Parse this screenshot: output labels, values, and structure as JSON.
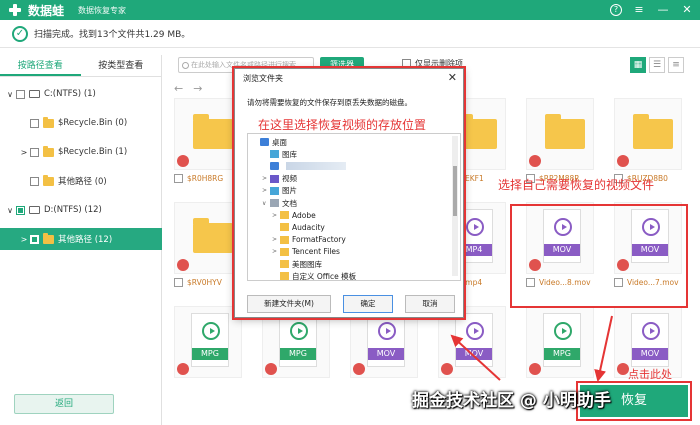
{
  "titlebar": {
    "app_name": "数据蛙",
    "subtitle": "数据恢复专家",
    "help_icon": "?",
    "menu_icon": "≡",
    "minimize_icon": "—",
    "close_icon": "✕"
  },
  "status": {
    "check_icon": "✓",
    "text": "扫描完成。找到13个文件共1.29 MB。"
  },
  "sidebar": {
    "tabs": [
      {
        "label": "按路径查看",
        "active": true
      },
      {
        "label": "按类型查看",
        "active": false
      }
    ],
    "tree": [
      {
        "chevron": "∨",
        "label": "C:(NTFS) (1)",
        "icon": "drive-icon",
        "selected": false
      },
      {
        "chevron": "",
        "label": "$Recycle.Bin (0)",
        "icon": "folder-icon",
        "selected": false
      },
      {
        "chevron": ">",
        "label": "$Recycle.Bin (1)",
        "icon": "folder-icon",
        "selected": false
      },
      {
        "chevron": "",
        "label": "其他路径 (0)",
        "icon": "folder-icon",
        "selected": false
      },
      {
        "chevron": "∨",
        "label": "D:(NTFS) (12)",
        "icon": "drive-icon",
        "selected": false
      },
      {
        "chevron": ">",
        "label": "其他路径 (12)",
        "icon": "folder-icon",
        "selected": true
      }
    ],
    "back_label": "返回"
  },
  "toolbar": {
    "search_placeholder": "在此处输入文件名或路径进行搜索",
    "filter_label": "筛选器",
    "show_deleted_label": "仅显示删除项",
    "view_icons": [
      "▦",
      "☰",
      "≡"
    ],
    "nav_back": "←",
    "nav_forward": "→"
  },
  "grid": {
    "tiles": [
      {
        "kind": "folder",
        "label": "$R0H8RG",
        "checked": false
      },
      {
        "kind": "folder",
        "label": "",
        "checked": false
      },
      {
        "kind": "folder",
        "label": "",
        "checked": false
      },
      {
        "kind": "folder",
        "label": "$RTEKF1",
        "checked": false
      },
      {
        "kind": "folder",
        "label": "$RP2M88R",
        "checked": false
      },
      {
        "kind": "folder",
        "label": "$RUZD8B0",
        "checked": false
      },
      {
        "kind": "folder",
        "label": "$RV0HYV",
        "checked": false
      },
      {
        "kind": "video",
        "badge": "MP4",
        "label": "...9.mp4",
        "checked": false
      },
      {
        "kind": "video",
        "badge": "MOV",
        "label": "Video...8.mov",
        "checked": false
      },
      {
        "kind": "video",
        "badge": "MOV",
        "label": "Video...7.mov",
        "checked": false
      },
      {
        "kind": "video",
        "badge": "MPG",
        "label": "",
        "checked": false
      },
      {
        "kind": "video",
        "badge": "MPG",
        "label": "",
        "checked": false
      },
      {
        "kind": "video",
        "badge": "MOV",
        "label": "",
        "checked": false
      },
      {
        "kind": "video",
        "badge": "MOV",
        "label": "",
        "checked": false
      },
      {
        "kind": "video",
        "badge": "MPG",
        "label": "",
        "checked": false
      },
      {
        "kind": "video",
        "badge": "MOV",
        "label": "",
        "checked": false
      }
    ]
  },
  "dialog": {
    "title": "浏览文件夹",
    "close_icon": "✕",
    "description": "请勿将需要恢复的文件保存到原丢失数据的磁盘。",
    "tree": [
      {
        "label": "桌面",
        "icon": "desktop-icon",
        "chevron": "",
        "level": 0
      },
      {
        "label": "图库",
        "icon": "gallery-icon",
        "chevron": "",
        "level": 1
      },
      {
        "label": "",
        "icon": "user-icon",
        "chevron": "",
        "level": 1,
        "blurred": true
      },
      {
        "label": "视频",
        "icon": "video-folder-icon",
        "chevron": ">",
        "level": 1
      },
      {
        "label": "图片",
        "icon": "picture-folder-icon",
        "chevron": ">",
        "level": 1
      },
      {
        "label": "文档",
        "icon": "document-folder-icon",
        "chevron": "∨",
        "level": 1
      },
      {
        "label": "Adobe",
        "icon": "folder-icon",
        "chevron": ">",
        "level": 2
      },
      {
        "label": "Audacity",
        "icon": "folder-icon",
        "chevron": "",
        "level": 2
      },
      {
        "label": "FormatFactory",
        "icon": "folder-icon",
        "chevron": ">",
        "level": 2
      },
      {
        "label": "Tencent Files",
        "icon": "folder-icon",
        "chevron": ">",
        "level": 2
      },
      {
        "label": "美图图库",
        "icon": "folder-icon",
        "chevron": "",
        "level": 2
      },
      {
        "label": "自定义 Office 模板",
        "icon": "folder-icon",
        "chevron": "",
        "level": 2
      }
    ],
    "new_folder_label": "新建文件夹(M)",
    "ok_label": "确定",
    "cancel_label": "取消"
  },
  "annotations": {
    "dialog_note": "在这里选择恢复视频的存放位置",
    "select_note": "选择自己需要恢复的视频文件",
    "click_note": "点击此处",
    "color": "#e53535"
  },
  "footer": {
    "next_label": "恢复",
    "watermark": "掘金技术社区 @ 小明助手"
  }
}
